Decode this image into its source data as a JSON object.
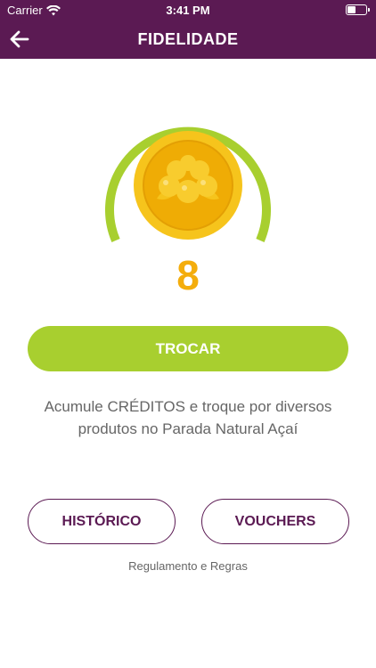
{
  "status_bar": {
    "carrier": "Carrier",
    "time": "3:41 PM"
  },
  "nav": {
    "title": "FIDELIDADE",
    "back_icon": "arrow-left-icon"
  },
  "loyalty": {
    "points": "8",
    "badge_icon": "acai-coin-icon",
    "colors": {
      "ring": "#a8cf2f",
      "coin_outer": "#f6c41c",
      "coin_inner": "#efac05",
      "points_text": "#f4ad0c"
    }
  },
  "actions": {
    "trocar_label": "TROCAR",
    "historico_label": "HISTÓRICO",
    "vouchers_label": "VOUCHERS",
    "rules_label": "Regulamento e Regras"
  },
  "description": "Acumule CRÉDITOS e troque por diversos produtos no Parada Natural Açaí",
  "theme": {
    "header": "#5b1a53",
    "accent": "#a8cf2f",
    "text_muted": "#666666"
  }
}
